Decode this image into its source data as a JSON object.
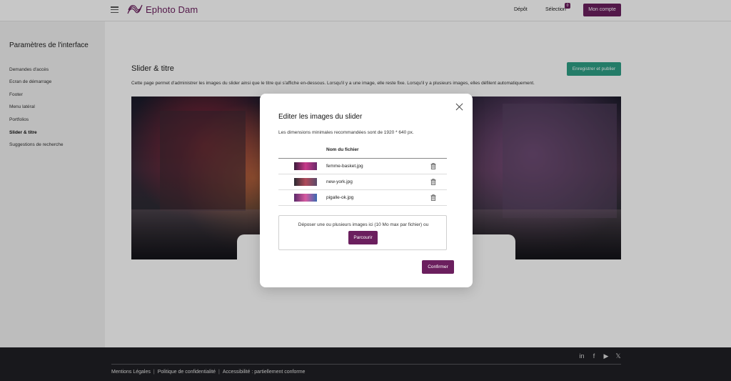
{
  "header": {
    "brand": "Ephoto Dam",
    "nav_depot": "Dépôt",
    "nav_selection": "Sélection",
    "selection_count": "0",
    "account_button": "Mon compte"
  },
  "sidebar": {
    "title": "Paramètres de l'interface",
    "items": [
      {
        "label": "Demandes d'accès",
        "active": false
      },
      {
        "label": "Ecran de démarrage",
        "active": false
      },
      {
        "label": "Footer",
        "active": false
      },
      {
        "label": "Menu latéral",
        "active": false
      },
      {
        "label": "Portfolios",
        "active": false
      },
      {
        "label": "Slider & titre",
        "active": true
      },
      {
        "label": "Suggestions de recherche",
        "active": false
      }
    ]
  },
  "main": {
    "title": "Slider & titre",
    "publish_button": "Enregistrer et publier",
    "description": "Cette page permet d'administrer les images du slider ainsi que le titre qui s'affiche en-dessous. Lorsqu'il y a une image, elle reste fixe. Lorsqu'il y a plusieurs images, elles défilent automatiquement."
  },
  "modal": {
    "title": "Editer les images du slider",
    "subtitle": "Les dimensions minimales recommandées sont de 1920 * 640 px.",
    "column_header": "Nom du fichier",
    "files": [
      {
        "name": "femme-basket.jpg",
        "thumb_colors": [
          "#3a1a3a",
          "#c83a8a",
          "#6a2a6a"
        ]
      },
      {
        "name": "new-york.jpg",
        "thumb_colors": [
          "#2a2a32",
          "#b04a5a",
          "#5a4a6a"
        ]
      },
      {
        "name": "pigalle-ok.jpg",
        "thumb_colors": [
          "#5a2a6a",
          "#d85aa0",
          "#3a6ab0"
        ]
      }
    ],
    "dropzone_text": "Déposer une ou plusieurs images ici (10 Mo max par fichier) ou",
    "browse_button": "Parcourir",
    "confirm_button": "Confirmer"
  },
  "footer": {
    "links": [
      "Mentions Légales",
      "Politique de confidentialité",
      "Accessibilité : partiellement conforme"
    ],
    "separator": "|",
    "social": [
      {
        "icon": "linkedin-icon",
        "glyph": "in"
      },
      {
        "icon": "facebook-icon",
        "glyph": "f"
      },
      {
        "icon": "youtube-icon",
        "glyph": "▶"
      },
      {
        "icon": "x-icon",
        "glyph": "𝕏"
      }
    ]
  },
  "colors": {
    "brand": "#6b1f5e",
    "publish": "#2f9f86",
    "footer_bg": "#1f1f24",
    "sidebar_bg": "#f2f2f2"
  }
}
